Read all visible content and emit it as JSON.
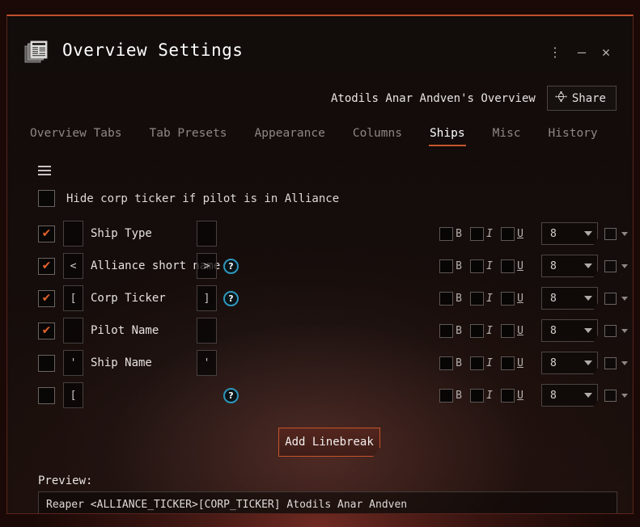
{
  "window": {
    "title": "Overview Settings",
    "icon": "documents-icon",
    "menu_glyph": "⋮",
    "minimize_glyph": "—",
    "close_glyph": "✕"
  },
  "preset": {
    "name": "Atodils Anar Andven's Overview",
    "share_label": "Share",
    "share_icon": "share-node-icon"
  },
  "tabs": [
    {
      "label": "Overview Tabs",
      "active": false
    },
    {
      "label": "Tab Presets",
      "active": false
    },
    {
      "label": "Appearance",
      "active": false
    },
    {
      "label": "Columns",
      "active": false
    },
    {
      "label": "Ships",
      "active": true
    },
    {
      "label": "Misc",
      "active": false
    },
    {
      "label": "History",
      "active": false
    }
  ],
  "master": {
    "handle_icon": "drag-handle-icon",
    "label": "Hide corp ticker if pilot is in Alliance",
    "checked": false
  },
  "format_controls": {
    "bold_letter": "B",
    "italic_letter": "I",
    "underline_letter": "U",
    "size_value": "8",
    "caret_glyph": "▼",
    "help_glyph": "?"
  },
  "rows": [
    {
      "name": "ship-type",
      "checked": true,
      "prefix": "",
      "label": "Ship Type",
      "suffix": "",
      "help": false,
      "bold": false,
      "italic": false,
      "underline": false,
      "size": "8"
    },
    {
      "name": "alliance-short-name",
      "checked": true,
      "prefix": "<",
      "label": "Alliance short name",
      "suffix": ">",
      "help": true,
      "bold": false,
      "italic": false,
      "underline": false,
      "size": "8"
    },
    {
      "name": "corp-ticker",
      "checked": true,
      "prefix": "[",
      "label": "Corp Ticker",
      "suffix": "]",
      "help": true,
      "bold": false,
      "italic": false,
      "underline": false,
      "size": "8"
    },
    {
      "name": "pilot-name",
      "checked": true,
      "prefix": "",
      "label": "Pilot Name",
      "suffix": "",
      "help": false,
      "bold": false,
      "italic": false,
      "underline": false,
      "size": "8"
    },
    {
      "name": "ship-name",
      "checked": false,
      "prefix": "'",
      "label": "Ship Name",
      "suffix": "'",
      "help": false,
      "bold": false,
      "italic": false,
      "underline": false,
      "size": "8"
    },
    {
      "name": "empty-slot",
      "checked": false,
      "prefix": "[",
      "label": "",
      "suffix": "",
      "help": true,
      "bold": false,
      "italic": false,
      "underline": false,
      "size": "8"
    }
  ],
  "actions": {
    "add_linebreak_label": "Add Linebreak"
  },
  "preview": {
    "label": "Preview:",
    "text": "Reaper <ALLIANCE_TICKER>[CORP_TICKER] Atodils Anar Andven"
  },
  "colors": {
    "accent": "#c4552d",
    "check": "#e2622c",
    "help_ring": "#2e97bd",
    "window_bg": "#150d0b",
    "text": "#e6e2e0"
  }
}
